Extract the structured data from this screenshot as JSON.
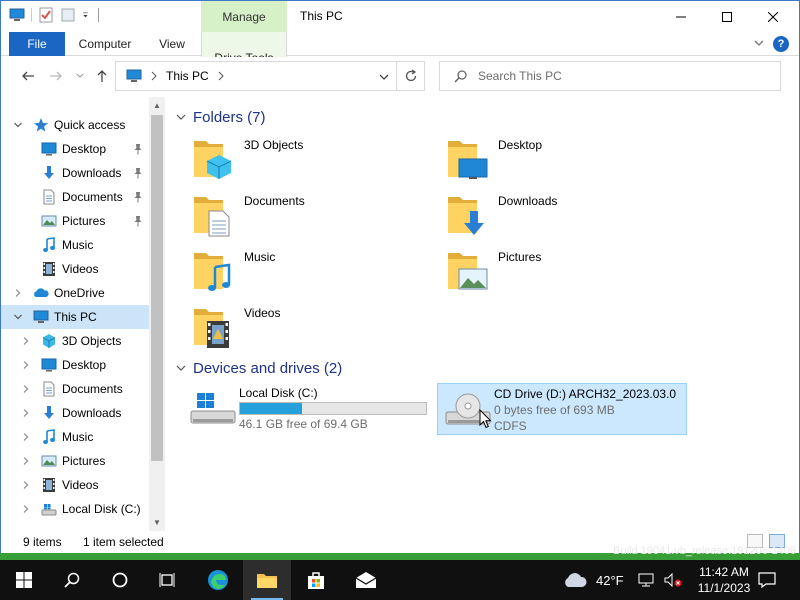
{
  "window": {
    "title": "This PC",
    "contextual_tab": "Manage",
    "ribbon_tabs": [
      "File",
      "Computer",
      "View",
      "Drive Tools"
    ]
  },
  "address": {
    "path": "This PC",
    "search_placeholder": "Search This PC"
  },
  "nav_tree": [
    {
      "label": "Quick access",
      "icon": "star-icon",
      "level": 0,
      "expander": "expanded"
    },
    {
      "label": "Desktop",
      "icon": "desktop-icon",
      "level": 1,
      "pinned": true
    },
    {
      "label": "Downloads",
      "icon": "downloads-icon",
      "level": 1,
      "pinned": true
    },
    {
      "label": "Documents",
      "icon": "documents-icon",
      "level": 1,
      "pinned": true
    },
    {
      "label": "Pictures",
      "icon": "pictures-icon",
      "level": 1,
      "pinned": true
    },
    {
      "label": "Music",
      "icon": "music-icon",
      "level": 1
    },
    {
      "label": "Videos",
      "icon": "videos-icon",
      "level": 1
    },
    {
      "label": "OneDrive",
      "icon": "onedrive-icon",
      "level": 0,
      "expander": "collapsed"
    },
    {
      "label": "This PC",
      "icon": "this-pc-icon",
      "level": 0,
      "expander": "expanded",
      "selected": true
    },
    {
      "label": "3D Objects",
      "icon": "3d-objects-icon",
      "level": 1,
      "expander": "collapsed"
    },
    {
      "label": "Desktop",
      "icon": "desktop-icon",
      "level": 1,
      "expander": "collapsed"
    },
    {
      "label": "Documents",
      "icon": "documents-icon",
      "level": 1,
      "expander": "collapsed"
    },
    {
      "label": "Downloads",
      "icon": "downloads-icon",
      "level": 1,
      "expander": "collapsed"
    },
    {
      "label": "Music",
      "icon": "music-icon",
      "level": 1,
      "expander": "collapsed"
    },
    {
      "label": "Pictures",
      "icon": "pictures-icon",
      "level": 1,
      "expander": "collapsed"
    },
    {
      "label": "Videos",
      "icon": "videos-icon",
      "level": 1,
      "expander": "collapsed"
    },
    {
      "label": "Local Disk (C:)",
      "icon": "local-disk-icon",
      "level": 1,
      "expander": "collapsed"
    }
  ],
  "folders_group": {
    "header": "Folders (7)",
    "items": [
      {
        "name": "3D Objects",
        "icon": "3d-objects-folder-icon"
      },
      {
        "name": "Desktop",
        "icon": "desktop-folder-icon"
      },
      {
        "name": "Documents",
        "icon": "documents-folder-icon"
      },
      {
        "name": "Downloads",
        "icon": "downloads-folder-icon"
      },
      {
        "name": "Music",
        "icon": "music-folder-icon"
      },
      {
        "name": "Pictures",
        "icon": "pictures-folder-icon"
      },
      {
        "name": "Videos",
        "icon": "videos-folder-icon"
      }
    ]
  },
  "drives_group": {
    "header": "Devices and drives (2)",
    "items": [
      {
        "name": "Local Disk (C:)",
        "free_text": "46.1 GB free of 69.4 GB",
        "used_fraction": 0.336,
        "icon": "windows-drive-icon"
      },
      {
        "name": "CD Drive (D:) ARCH32_2023.03.0",
        "free_text": "0 bytes free of 693 MB",
        "filesystem": "CDFS",
        "icon": "cd-drive-icon",
        "selected": true
      }
    ]
  },
  "status": {
    "item_count": "9 items",
    "selection": "1 item selected"
  },
  "desktop_watermark": "Build 19041.vb_release.191206-1406",
  "taskbar": {
    "weather_temp": "42°F",
    "time": "11:42 AM",
    "date": "11/1/2023"
  },
  "colors": {
    "accent": "#1a66c2",
    "selection": "#cce8ff",
    "drive_fill": "#26a0da",
    "group_header": "#1e3287",
    "manage_tab": "#d6f0c8"
  }
}
